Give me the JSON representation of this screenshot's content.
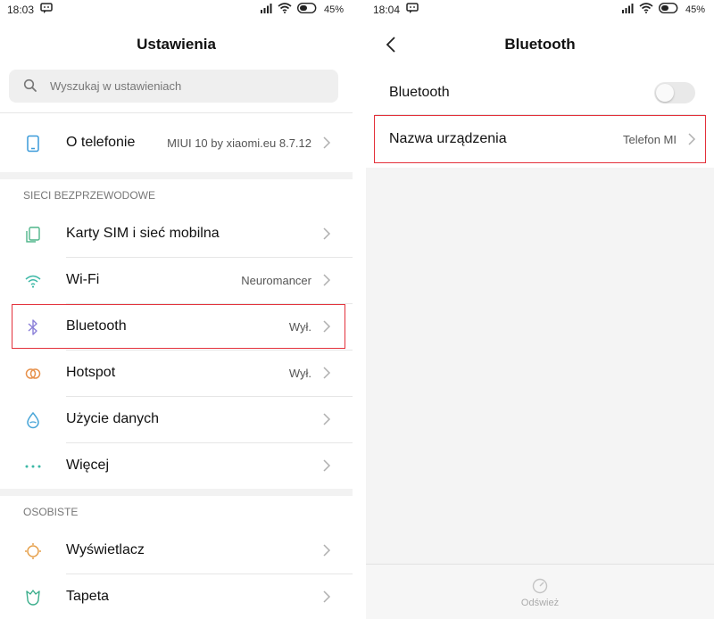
{
  "left": {
    "status": {
      "time": "18:03",
      "battery": "45%"
    },
    "title": "Ustawienia",
    "search": {
      "placeholder": "Wyszukaj w ustawieniach"
    },
    "about": {
      "label": "O telefonie",
      "value": "MIUI 10 by xiaomi.eu 8.7.12"
    },
    "sections": {
      "wireless": "SIECI BEZPRZEWODOWE",
      "personal": "OSOBISTE"
    },
    "items": [
      {
        "label": "Karty SIM i sieć mobilna",
        "value": "",
        "icon": "sim-card-icon"
      },
      {
        "label": "Wi-Fi",
        "value": "Neuromancer",
        "icon": "wifi-icon"
      },
      {
        "label": "Bluetooth",
        "value": "Wył.",
        "icon": "bluetooth-icon"
      },
      {
        "label": "Hotspot",
        "value": "Wył.",
        "icon": "hotspot-icon"
      },
      {
        "label": "Użycie danych",
        "value": "",
        "icon": "data-usage-icon"
      },
      {
        "label": "Więcej",
        "value": "",
        "icon": "more-dots-icon"
      }
    ],
    "personal_items": [
      {
        "label": "Wyświetlacz",
        "icon": "display-sun-icon"
      },
      {
        "label": "Tapeta",
        "icon": "wallpaper-tulip-icon"
      }
    ]
  },
  "right": {
    "status": {
      "time": "18:04",
      "battery": "45%"
    },
    "title": "Bluetooth",
    "bluetooth_toggle": {
      "label": "Bluetooth",
      "on": false
    },
    "device_name": {
      "label": "Nazwa urządzenia",
      "value": "Telefon MI"
    },
    "refresh_label": "Odśwież"
  },
  "colors": {
    "highlight": "#e3303a",
    "wifi": "#3cb8a6",
    "bluetooth": "#8a7fd8",
    "hotspot": "#e7924d",
    "data": "#4aa6d8",
    "sim": "#4fb58a",
    "about": "#3a9ad9",
    "display": "#e6a14d",
    "wallpaper": "#3cae8c"
  }
}
